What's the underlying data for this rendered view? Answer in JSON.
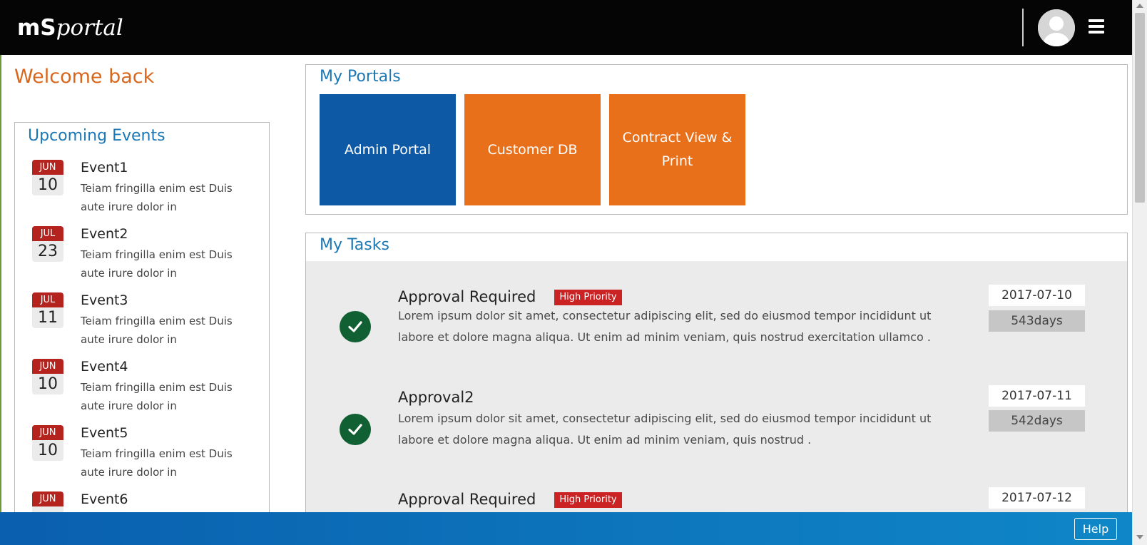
{
  "header": {
    "logo_bold": "mS",
    "logo_italic": "portal",
    "avatar_icon": "user-avatar-icon",
    "menu_icon": "hamburger-menu-icon"
  },
  "welcome": "Welcome back",
  "events": {
    "title": "Upcoming Events",
    "items": [
      {
        "month": "JUN",
        "day": "10",
        "name": "Event1",
        "desc": "Teiam fringilla enim est Duis aute irure dolor in"
      },
      {
        "month": "JUL",
        "day": "23",
        "name": "Event2",
        "desc": "Teiam fringilla enim est Duis aute irure dolor in"
      },
      {
        "month": "JUL",
        "day": "11",
        "name": "Event3",
        "desc": "Teiam fringilla enim est Duis aute irure dolor in"
      },
      {
        "month": "JUN",
        "day": "10",
        "name": "Event4",
        "desc": "Teiam fringilla enim est Duis aute irure dolor in"
      },
      {
        "month": "JUN",
        "day": "10",
        "name": "Event5",
        "desc": "Teiam fringilla enim est Duis aute irure dolor in"
      },
      {
        "month": "JUN",
        "day": "",
        "name": "Event6",
        "desc": ""
      }
    ]
  },
  "portals": {
    "title": "My Portals",
    "tiles": [
      {
        "label": "Admin Portal",
        "color": "#0e59a6"
      },
      {
        "label": "Customer DB",
        "color": "#e8701b"
      },
      {
        "label": "Contract View & Print",
        "color": "#e8701b"
      }
    ]
  },
  "tasks": {
    "title": "My Tasks",
    "items": [
      {
        "title": "Approval Required",
        "badge": "High Priority",
        "desc": "Lorem ipsum dolor sit amet, consectetur adipiscing elit, sed do eiusmod tempor incididunt ut labore et dolore magna aliqua. Ut enim ad minim veniam, quis nostrud exercitation ullamco .",
        "date": "2017-07-10",
        "days": "543days"
      },
      {
        "title": "Approval2",
        "badge": "",
        "desc": "Lorem ipsum dolor sit amet, consectetur adipiscing elit, sed do eiusmod tempor incididunt ut labore et dolore magna aliqua. Ut enim ad minim veniam, quis nostrud .",
        "date": "2017-07-11",
        "days": "542days"
      },
      {
        "title": "Approval Required",
        "badge": "High Priority",
        "desc": "",
        "date": "2017-07-12",
        "days": ""
      }
    ]
  },
  "footer": {
    "help_label": "Help"
  },
  "colors": {
    "accent_blue": "#1b78b5",
    "welcome_orange": "#d8671e",
    "priority_red": "#cb2223",
    "check_green": "#106033"
  }
}
